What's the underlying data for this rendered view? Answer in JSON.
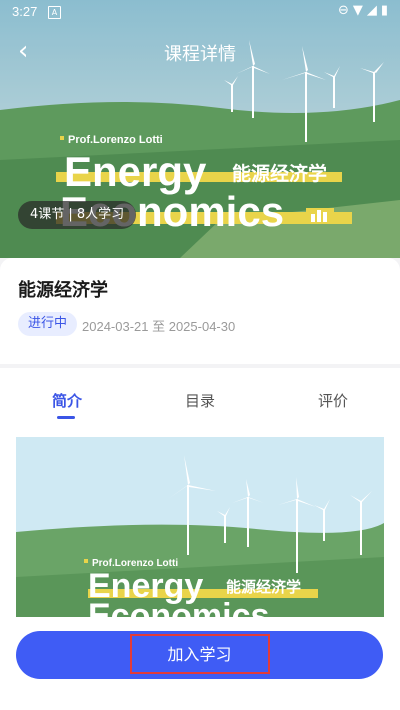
{
  "status_bar": {
    "time": "3:27",
    "badge": "A"
  },
  "nav": {
    "title": "课程详情"
  },
  "banner": {
    "professor": "Prof.Lorenzo Lotti",
    "title_line1": "Energy",
    "title_line2": "Economics",
    "title_cn": "能源经济学",
    "meta": "4课节 | 8人学习"
  },
  "course": {
    "name": "能源经济学",
    "status": "进行中",
    "dates": "2024-03-21 至 2025-04-30"
  },
  "tabs": [
    {
      "label": "简介",
      "active": true
    },
    {
      "label": "目录",
      "active": false
    },
    {
      "label": "评价",
      "active": false
    }
  ],
  "intro": {
    "professor": "Prof.Lorenzo Lotti",
    "title_line1": "Energy",
    "title_line2": "Economics",
    "title_cn": "能源经济学"
  },
  "action": {
    "join_label": "加入学习"
  },
  "colors": {
    "accent": "#3f5cf5",
    "sky": "#cfe9f3",
    "grass": "#5f9a5e",
    "banner_yellow": "#e9d44a"
  }
}
